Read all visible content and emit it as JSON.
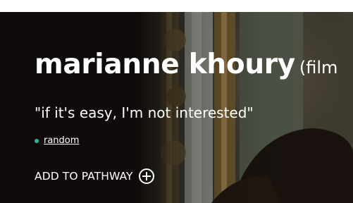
{
  "hero": {
    "name": "marianne khoury",
    "name_suffix": "(film",
    "quote": "\"if it's easy, I'm not interested\"",
    "tag_link": "random",
    "add_to_pathway": "ADD TO PATHWAY"
  },
  "colors": {
    "background_dark": "#0e0b0a",
    "text": "#ffffff",
    "tag_dot": "#2bb5a0"
  },
  "icons": {
    "add": "plus-circle-icon",
    "tag": "dot-icon"
  }
}
